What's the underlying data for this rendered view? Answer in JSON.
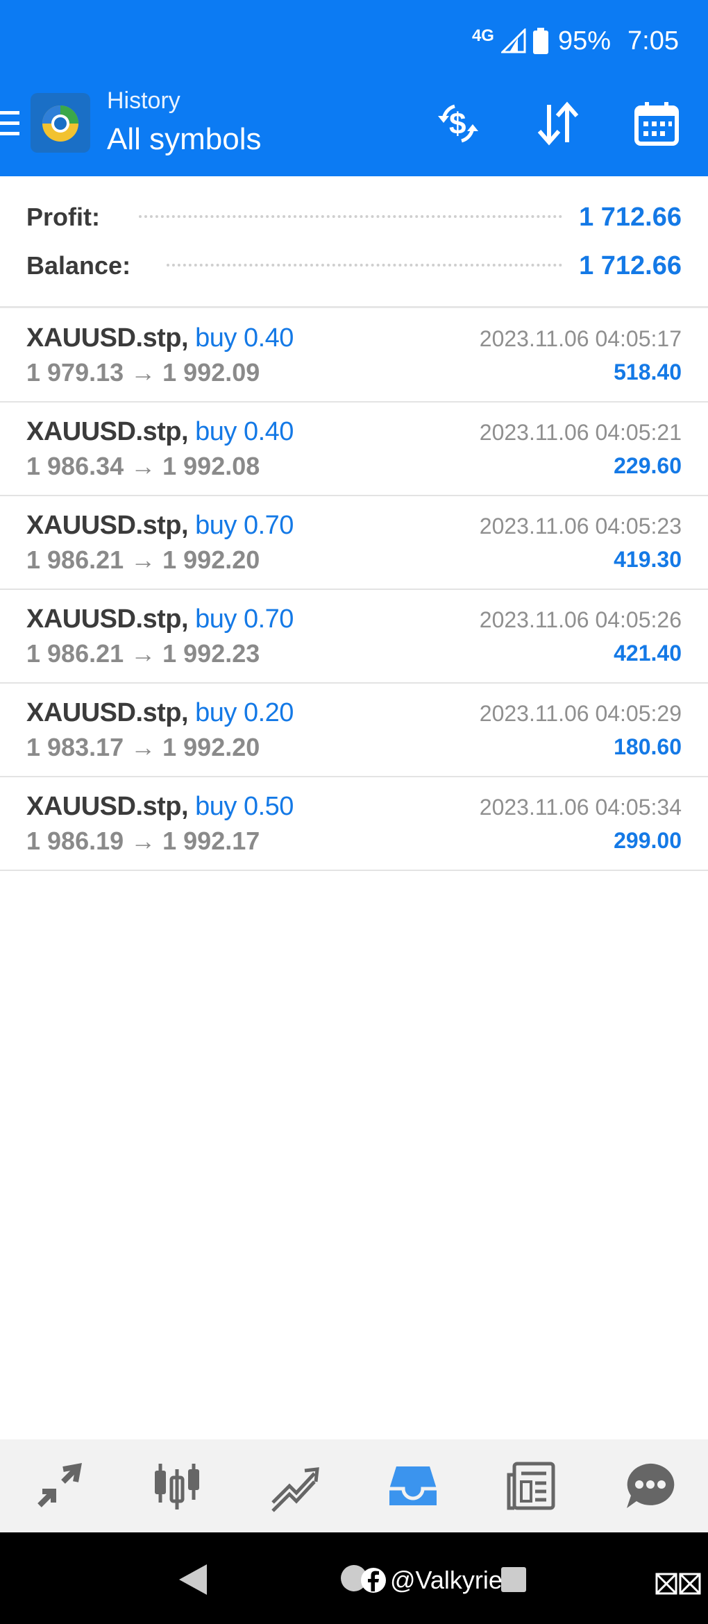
{
  "status": {
    "network": "4G",
    "battery": "95%",
    "time": "7:05"
  },
  "header": {
    "subtitle": "History",
    "title": "All symbols"
  },
  "summary": {
    "profit_label": "Profit:",
    "profit_value": "1 712.66",
    "balance_label": "Balance:",
    "balance_value": "1 712.66"
  },
  "deals": [
    {
      "symbol": "XAUUSD.stp,",
      "side": "buy 0.40",
      "prices": "1 979.13 → 1 992.09",
      "time": "2023.11.06 04:05:17",
      "profit": "518.40"
    },
    {
      "symbol": "XAUUSD.stp,",
      "side": "buy 0.40",
      "prices": "1 986.34 → 1 992.08",
      "time": "2023.11.06 04:05:21",
      "profit": "229.60"
    },
    {
      "symbol": "XAUUSD.stp,",
      "side": "buy 0.70",
      "prices": "1 986.21 → 1 992.20",
      "time": "2023.11.06 04:05:23",
      "profit": "419.30"
    },
    {
      "symbol": "XAUUSD.stp,",
      "side": "buy 0.70",
      "prices": "1 986.21 → 1 992.23",
      "time": "2023.11.06 04:05:26",
      "profit": "421.40"
    },
    {
      "symbol": "XAUUSD.stp,",
      "side": "buy 0.20",
      "prices": "1 983.17 → 1 992.20",
      "time": "2023.11.06 04:05:29",
      "profit": "180.60"
    },
    {
      "symbol": "XAUUSD.stp,",
      "side": "buy 0.50",
      "prices": "1 986.19 → 1 992.17",
      "time": "2023.11.06 04:05:34",
      "profit": "299.00"
    }
  ],
  "icons": {
    "menu": "menu-icon",
    "exchange": "currency-exchange-icon",
    "sort": "sort-icon",
    "calendar": "calendar-icon",
    "nav": [
      "quotes-icon",
      "chart-icon",
      "trade-icon",
      "history-icon",
      "news-icon",
      "chat-icon"
    ]
  },
  "colors": {
    "header": "#0c7bf3",
    "accent": "#1479e6",
    "active_nav": "#3b94ee"
  },
  "watermark": "@Valkyrie"
}
